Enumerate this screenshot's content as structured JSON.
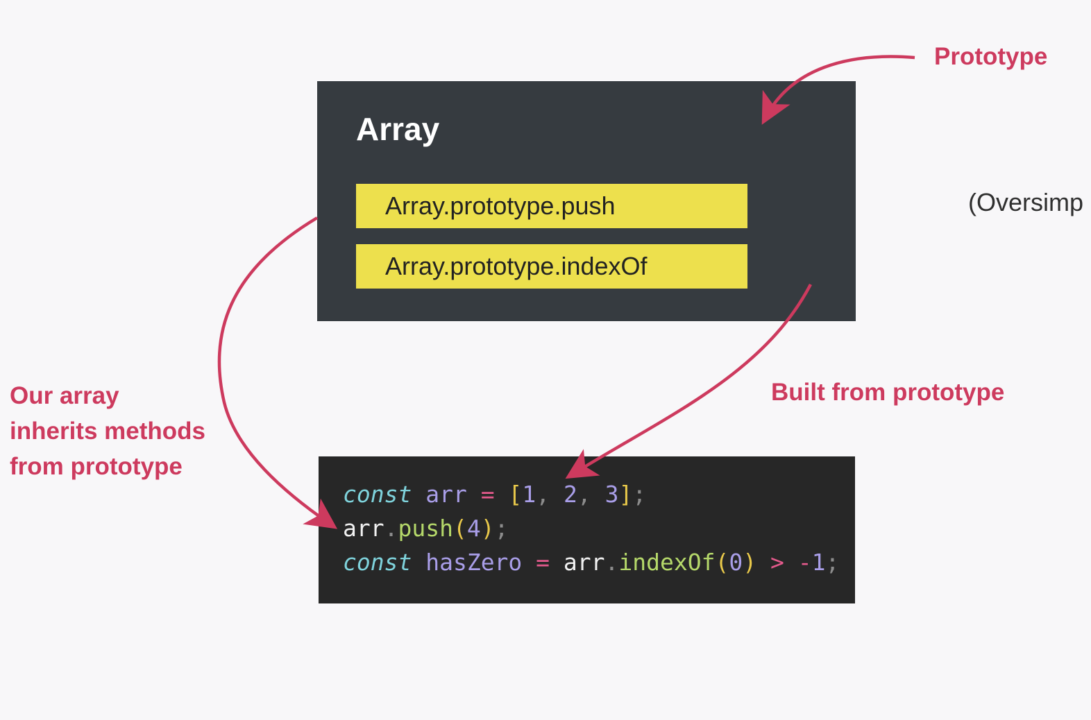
{
  "colors": {
    "background": "#f8f7f9",
    "prototype_box": "#363b40",
    "method_box": "#ede04d",
    "code_box": "#272727",
    "annotation": "#cd3a5e"
  },
  "prototype": {
    "title": "Array",
    "methods": [
      "Array.prototype.push",
      "Array.prototype.indexOf"
    ]
  },
  "code": {
    "lines": [
      [
        {
          "t": "const",
          "k": "keyword"
        },
        {
          "t": " ",
          "k": "plain"
        },
        {
          "t": "arr",
          "k": "var"
        },
        {
          "t": " ",
          "k": "plain"
        },
        {
          "t": "=",
          "k": "op"
        },
        {
          "t": " ",
          "k": "plain"
        },
        {
          "t": "[",
          "k": "bracket"
        },
        {
          "t": "1",
          "k": "num"
        },
        {
          "t": ", ",
          "k": "punct"
        },
        {
          "t": "2",
          "k": "num"
        },
        {
          "t": ", ",
          "k": "punct"
        },
        {
          "t": "3",
          "k": "num"
        },
        {
          "t": "]",
          "k": "bracket"
        },
        {
          "t": ";",
          "k": "punct"
        }
      ],
      [
        {
          "t": "arr",
          "k": "plain"
        },
        {
          "t": ".",
          "k": "punct"
        },
        {
          "t": "push",
          "k": "method"
        },
        {
          "t": "(",
          "k": "bracket"
        },
        {
          "t": "4",
          "k": "num"
        },
        {
          "t": ")",
          "k": "bracket"
        },
        {
          "t": ";",
          "k": "punct"
        }
      ],
      [
        {
          "t": "const",
          "k": "keyword"
        },
        {
          "t": " ",
          "k": "plain"
        },
        {
          "t": "hasZero",
          "k": "var"
        },
        {
          "t": " ",
          "k": "plain"
        },
        {
          "t": "=",
          "k": "op"
        },
        {
          "t": " ",
          "k": "plain"
        },
        {
          "t": "arr",
          "k": "plain"
        },
        {
          "t": ".",
          "k": "punct"
        },
        {
          "t": "indexOf",
          "k": "method"
        },
        {
          "t": "(",
          "k": "bracket"
        },
        {
          "t": "0",
          "k": "num"
        },
        {
          "t": ")",
          "k": "bracket"
        },
        {
          "t": " ",
          "k": "plain"
        },
        {
          "t": ">",
          "k": "op"
        },
        {
          "t": " ",
          "k": "plain"
        },
        {
          "t": "-",
          "k": "op"
        },
        {
          "t": "1",
          "k": "num"
        },
        {
          "t": ";",
          "k": "punct"
        }
      ]
    ]
  },
  "labels": {
    "prototype": "Prototype",
    "built_from": "Built from prototype",
    "inherits": [
      "Our array",
      "inherits methods",
      "from prototype"
    ],
    "note": "(Oversimp"
  },
  "arrows": [
    {
      "name": "prototype-arrow",
      "from": "Prototype",
      "to": "Array"
    },
    {
      "name": "built-from-arrow",
      "from": "Array",
      "to": "code"
    },
    {
      "name": "inherits-arrow",
      "from": "Array",
      "to": "code"
    }
  ]
}
